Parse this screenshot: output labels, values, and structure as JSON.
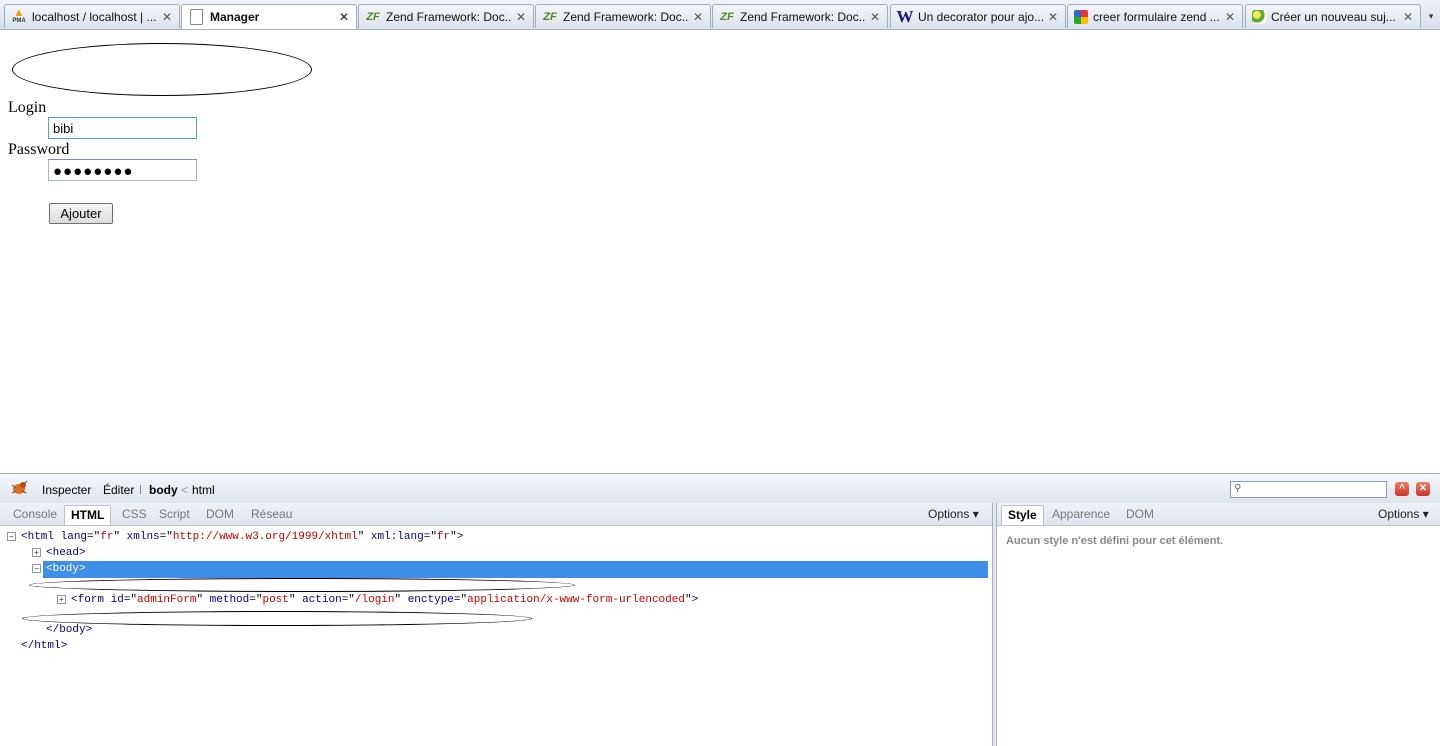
{
  "tabs": [
    {
      "title": "localhost / localhost | ...",
      "icon": "phpmyadmin-icon",
      "active": false
    },
    {
      "title": "Manager",
      "icon": "page-icon",
      "active": true
    },
    {
      "title": "Zend Framework: Doc...",
      "icon": "zend-framework-icon",
      "active": false
    },
    {
      "title": "Zend Framework: Doc...",
      "icon": "zend-framework-icon",
      "active": false
    },
    {
      "title": "Zend Framework: Doc...",
      "icon": "zend-framework-icon",
      "active": false
    },
    {
      "title": "Un decorator pour ajo...",
      "icon": "wordpress-icon",
      "active": false
    },
    {
      "title": "creer formulaire zend ...",
      "icon": "google-icon",
      "active": false
    },
    {
      "title": "Créer un nouveau suj...",
      "icon": "forum-icon",
      "active": false
    }
  ],
  "tab_icons": {
    "pma": "PMA",
    "zf": "ZF",
    "w": "W"
  },
  "form": {
    "login_label": "Login",
    "login_value": "bibi",
    "password_label": "Password",
    "password_display": "●●●●●●●●",
    "submit_label": "Ajouter"
  },
  "firebug": {
    "inspect_label": "Inspecter",
    "edit_label": "Éditer",
    "breadcrumb_current": "body",
    "breadcrumb_separator": "<",
    "breadcrumb_parent": "html",
    "search_placeholder": "",
    "panels": [
      "Console",
      "HTML",
      "CSS",
      "Script",
      "DOM",
      "Réseau"
    ],
    "selected_panel": "HTML",
    "options_label": "Options ▾",
    "side_panels": [
      "Style",
      "Apparence",
      "DOM"
    ],
    "side_selected": "Style",
    "side_options_label": "Options ▾",
    "side_message": "Aucun style n'est défini pour cet élément.",
    "tree": {
      "html_open": "<html",
      "html_attrs": [
        {
          "name": "lang",
          "value": "fr"
        },
        {
          "name": "xmlns",
          "value": "http://www.w3.org/1999/xhtml"
        },
        {
          "name": "xml:lang",
          "value": "fr"
        }
      ],
      "head": "<head>",
      "body": "<body>",
      "form_open": "<form",
      "form_attrs": [
        {
          "name": "id",
          "value": "adminForm"
        },
        {
          "name": "method",
          "value": "post"
        },
        {
          "name": "action",
          "value": "/login"
        },
        {
          "name": "enctype",
          "value": "application/x-www-form-urlencoded"
        }
      ],
      "body_close": "</body>",
      "html_close": "</html>"
    }
  },
  "colors": {
    "selection": "#3d8ee6",
    "tag": "#000088",
    "attr_value": "#cc0000"
  }
}
